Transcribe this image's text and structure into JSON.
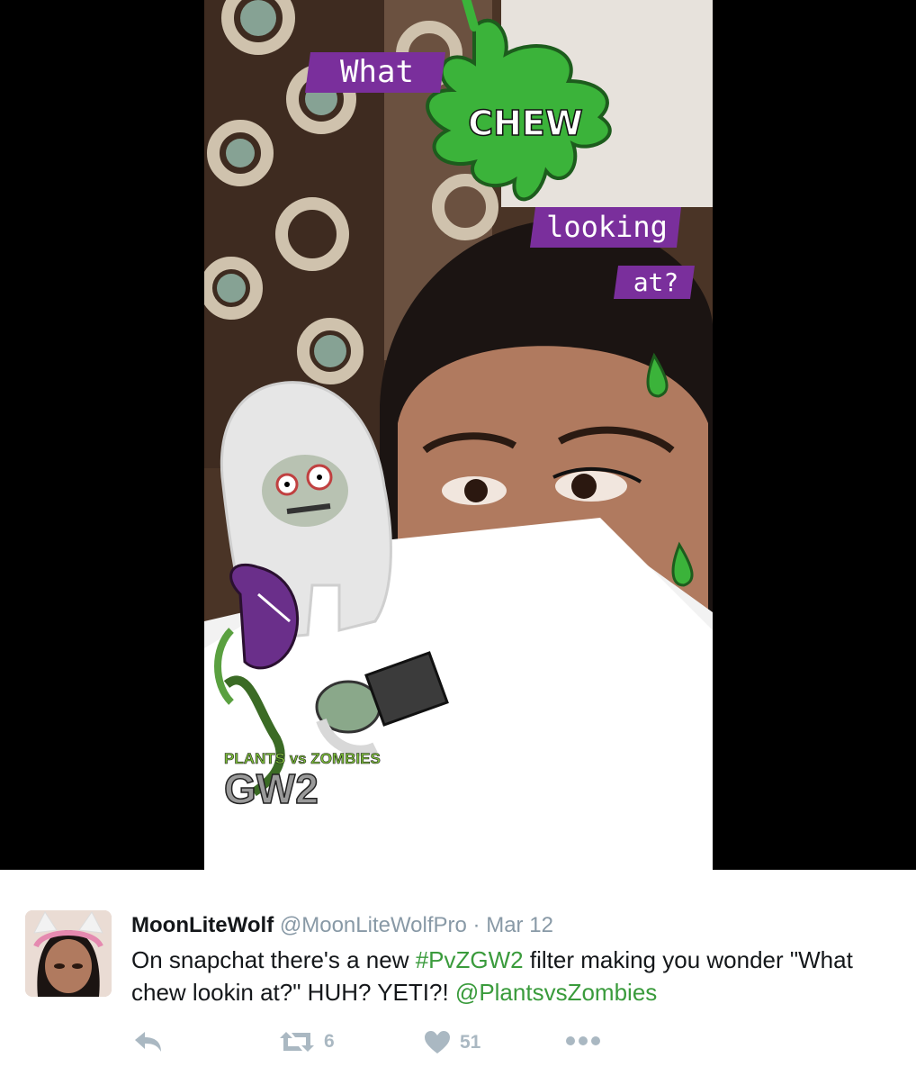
{
  "media": {
    "stickers": {
      "word1": "What",
      "word2": "CHEW",
      "word3": "looking",
      "word4": "at?",
      "logo_top": "PLANTS vs ZOMBIES",
      "logo_bottom": "GW2"
    }
  },
  "tweet": {
    "display_name": "MoonLiteWolf",
    "handle": "@MoonLiteWolfPro",
    "separator": "·",
    "date": "Mar 12",
    "text_part1": "On snapchat there's a new ",
    "hashtag": "#PvZGW2",
    "text_part2": " filter making you wonder \"What chew lookin at?\" HUH? YETI?! ",
    "mention": "@PlantsvsZombies",
    "actions": {
      "reply_icon": "reply-icon",
      "retweet_icon": "retweet-icon",
      "retweet_count": "6",
      "like_icon": "heart-icon",
      "like_count": "51",
      "more_icon": "more-icon"
    }
  },
  "colors": {
    "link": "#3a9b3c",
    "muted": "#8899a6",
    "action": "#aab8c2",
    "slime": "#3bb33a",
    "banner": "#7a2f9c"
  }
}
